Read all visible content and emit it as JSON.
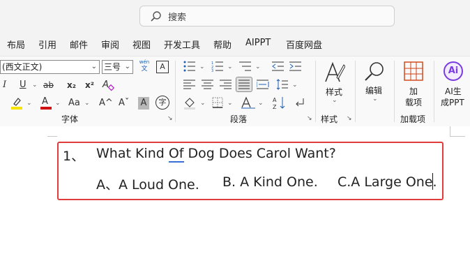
{
  "search": {
    "placeholder": "搜索"
  },
  "menu": {
    "items": [
      "布局",
      "引用",
      "邮件",
      "审阅",
      "视图",
      "开发工具",
      "帮助",
      "AIPPT",
      "百度网盘"
    ]
  },
  "font_group": {
    "font_name": "(西文正文)",
    "font_size": "三号",
    "phonetic_top": "wén",
    "phonetic_bottom": "文",
    "char_border": "A",
    "italic": "I",
    "underline": "U",
    "strike": "ab",
    "subscript": "x₂",
    "superscript": "x²",
    "clear_format": "A",
    "font_color": "A",
    "case": "Aa",
    "grow": "A^",
    "shrink": "Aˇ",
    "shade": "A",
    "enclose": "字",
    "label": "字体"
  },
  "paragraph_group": {
    "label": "段落"
  },
  "styles_group": {
    "button_label": "样式",
    "label": "样式"
  },
  "edit_group": {
    "button_label": "编辑"
  },
  "addins_group": {
    "button_label_line1": "加",
    "button_label_line2": "载项",
    "label": "加载项"
  },
  "ai_group": {
    "badge": "Ai",
    "button_label_line1": "AI生",
    "button_label_line2": "成PPT"
  },
  "document": {
    "question_number": "1、",
    "question_before": "What Kind ",
    "question_underlined": "Of",
    "question_after": " Dog Does Carol Want?",
    "option_a": "A、A Loud One.",
    "option_b": "B. A Kind One.",
    "option_c": "C.A Large One."
  },
  "colors": {
    "highlight": "#f5e400",
    "font_color": "#d01010",
    "answer_box_border": "#e03c3c",
    "addins_icon": "#d04010",
    "ai_icon": "#7a3ce0"
  }
}
